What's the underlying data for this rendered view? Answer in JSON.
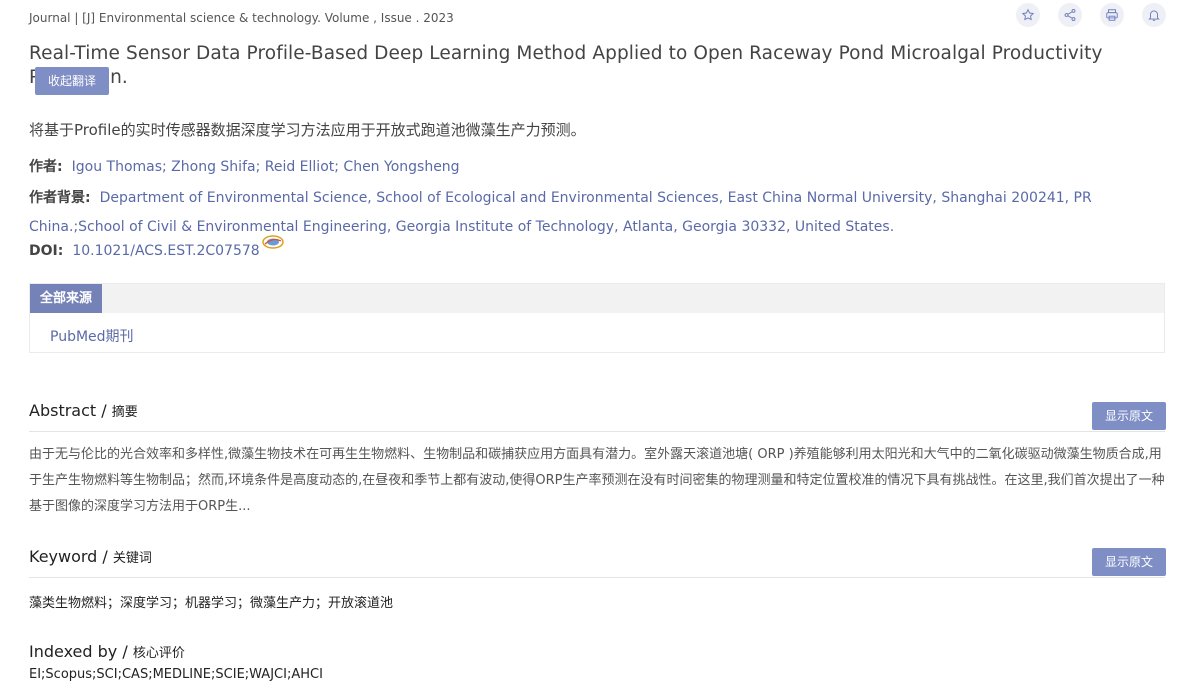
{
  "meta_line": "Journal | [J] Environmental science & technology. Volume , Issue . 2023",
  "icons": [
    "star-icon",
    "share-icon",
    "print-icon",
    "bell-icon"
  ],
  "title_en": "Real-Time Sensor Data Profile-Based Deep Learning Method Applied to Open Raceway Pond Microalgal Productivity Prediction.",
  "collapse_translation_label": "收起翻译",
  "title_cn": "将基于Profile的实时传感器数据深度学习方法应用于开放式跑道池微藻生产力预测。",
  "authors": {
    "label": "作者:",
    "value": "Igou Thomas; Zhong Shifa; Reid Elliot; Chen Yongsheng"
  },
  "affiliation": {
    "label": "作者背景:",
    "value": "Department of Environmental Science, School of Ecological and Environmental Sciences, East China Normal University, Shanghai 200241, PR China.;School of Civil & Environmental Engineering, Georgia Institute of Technology, Atlanta, Georgia 30332, United States."
  },
  "doi": {
    "label": "DOI:",
    "value": "10.1021/ACS.EST.2C07578"
  },
  "sources": {
    "tab_label": "全部来源",
    "items": [
      "PubMed期刊"
    ]
  },
  "abstract": {
    "title": "Abstract / ",
    "subtitle": "摘要",
    "show_original_label": "显示原文",
    "text": "由于无与伦比的光合效率和多样性,微藻生物技术在可再生生物燃料、生物制品和碳捕获应用方面具有潜力。室外露天滚道池塘( ORP )养殖能够利用太阳光和大气中的二氧化碳驱动微藻生物质合成,用于生产生物燃料等生物制品；然而,环境条件是高度动态的,在昼夜和季节上都有波动,使得ORP生产率预测在没有时间密集的物理测量和特定位置校准的情况下具有挑战性。在这里,我们首次提出了一种基于图像的深度学习方法用于ORP生..."
  },
  "keyword": {
    "title": "Keyword / ",
    "subtitle": "关键词",
    "show_original_label": "显示原文",
    "text": "藻类生物燃料；深度学习；机器学习；微藻生产力；开放滚道池"
  },
  "indexed": {
    "title": "Indexed by / ",
    "subtitle": "核心评价",
    "text": "EI;Scopus;SCI;CAS;MEDLINE;SCIE;WAJCI;AHCI"
  },
  "colors": {
    "accent": "#7f8ec5",
    "tab": "#7582b8",
    "link": "#5a6aa8"
  }
}
